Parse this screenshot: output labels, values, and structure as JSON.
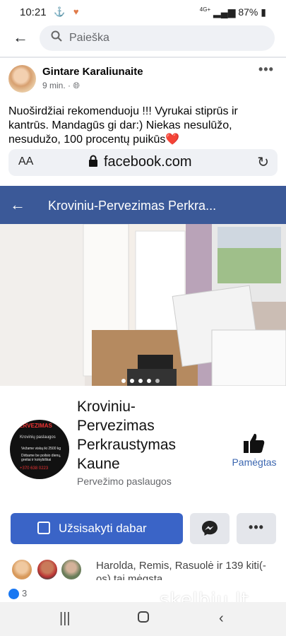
{
  "status_bar": {
    "time": "10:21",
    "network": "4G+",
    "battery": "87%"
  },
  "search": {
    "placeholder": "Paieška"
  },
  "post": {
    "author": "Gintare Karaliunaite",
    "time": "9 min. ·",
    "text": "Nuoširdžiai rekomenduoju !!! Vyrukai stiprūs ir kantrūs. Mandagūs gi dar:) Niekas nesulūžo, nesudužo, 100 procentų puikūs",
    "emoji": "❤️"
  },
  "browser": {
    "aa": "AA",
    "url": "facebook.com"
  },
  "embedded_page": {
    "header_title": "Kroviniu-Pervezimas Perkra...",
    "page_name": "Kroviniu-Pervezimas Perkraustymas Kaune",
    "category": "Pervežimo paslaugos",
    "liked_label": "Pamėgtas",
    "order_button": "Užsisakyti dabar",
    "friends_text": "Harolda, Remis, Rasuolė ir 139 kiti(-os) tai mėgsta",
    "profile_logo": {
      "line1": "PERVEZIMAS",
      "line2": "Krovinių paslaugos",
      "line3": "Vežame viską iki 2500 kg",
      "line4": "Dirbame be poilsio dienų, greitai ir kokybiškai",
      "phone": "+370 638 0223"
    }
  },
  "reactions": {
    "count": "3"
  },
  "watermark": "skelbiu.lt",
  "colors": {
    "brand": "#3b5998",
    "button": "#3a64c7",
    "liked": "#3b66b0"
  }
}
